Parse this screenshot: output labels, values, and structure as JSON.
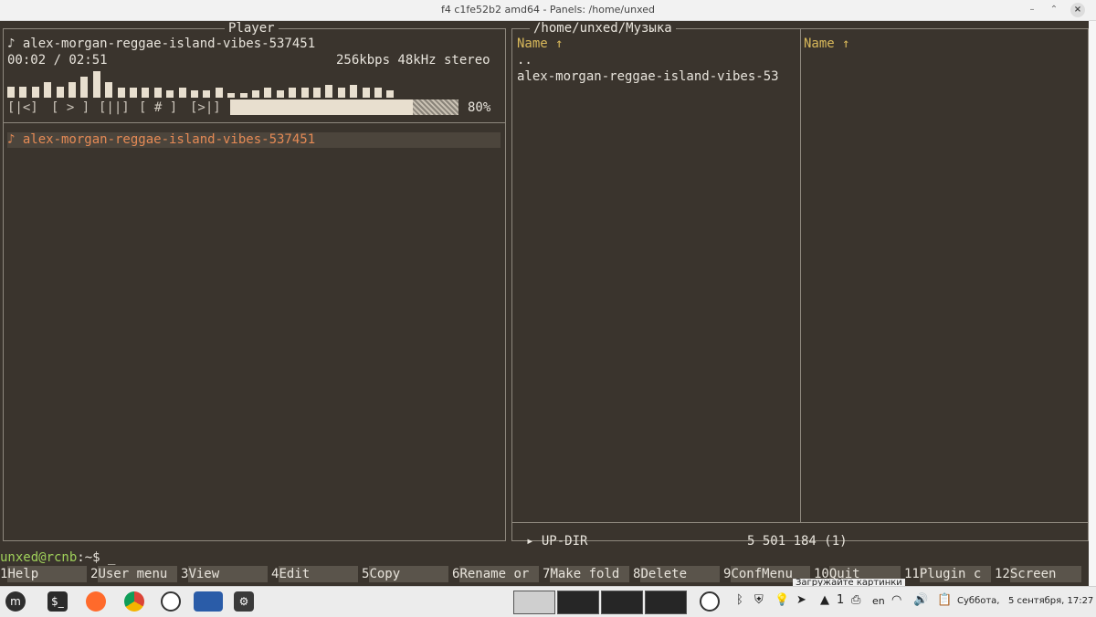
{
  "window": {
    "title": "f4 c1fe52b2 amd64 - Panels: /home/unxed",
    "minimize_glyph": "–",
    "maximize_glyph": "⌃",
    "close_glyph": "×"
  },
  "player": {
    "panel_title": "Player",
    "track_line": "♪ alex-morgan-reggae-island-vibes-537451",
    "time": "00:02 / 02:51",
    "format": "256kbps 48kHz stereo",
    "controls": {
      "prev": "[|<]",
      "play": "[ > ]",
      "pause": "[||]",
      "stop": "[ # ]",
      "next": "[>|]"
    },
    "progress_percent": 80,
    "progress_label": "80%",
    "elapsed_fraction": 0.012,
    "vu_levels": [
      0.4,
      0.4,
      0.4,
      0.55,
      0.4,
      0.55,
      0.75,
      0.95,
      0.55,
      0.35,
      0.35,
      0.35,
      0.35,
      0.25,
      0.35,
      0.25,
      0.25,
      0.35,
      0.15,
      0.15,
      0.25,
      0.35,
      0.25,
      0.35,
      0.35,
      0.35,
      0.45,
      0.35,
      0.45,
      0.35,
      0.35,
      0.25
    ],
    "playlist": [
      {
        "label": "♪ alex-morgan-reggae-island-vibes-537451",
        "selected": true
      }
    ]
  },
  "files": {
    "panel_title": "/home/unxed/Музыка",
    "col1_header": "Name ↑",
    "col2_header": "Name ↑",
    "items": [
      {
        "name": ".."
      },
      {
        "name": "alex-morgan-reggae-island-vibes-53"
      }
    ],
    "status_left": "▸ UP-DIR",
    "status_right": "5 501 184 (1)"
  },
  "prompt": {
    "user_host": "unxed@rcnb",
    "path_symbol": ":~$",
    "cursor": "_"
  },
  "fkeys": [
    {
      "num": "1",
      "label": "Help"
    },
    {
      "num": "2",
      "label": "User menu"
    },
    {
      "num": "3",
      "label": "View"
    },
    {
      "num": "4",
      "label": "Edit"
    },
    {
      "num": "5",
      "label": "Copy"
    },
    {
      "num": "6",
      "label": "Rename or"
    },
    {
      "num": "7",
      "label": "Make fold"
    },
    {
      "num": "8",
      "label": "Delete"
    },
    {
      "num": "9",
      "label": "ConfMenu"
    },
    {
      "num": "10",
      "label": "Quit"
    },
    {
      "num": "11",
      "label": "Plugin c"
    },
    {
      "num": "12",
      "label": "Screen"
    }
  ],
  "taskbar": {
    "tooltip": "Загружайте картинки",
    "apps": [
      {
        "icon": "mint-menu-icon"
      },
      {
        "icon": "terminal-icon",
        "glyph": "$_"
      },
      {
        "icon": "firefox-icon"
      },
      {
        "icon": "chrome-icon"
      },
      {
        "icon": "chatgpt-icon"
      },
      {
        "icon": "file-manager-icon"
      },
      {
        "icon": "settings-icon"
      }
    ],
    "tray_count": "1",
    "keyboard_layout": "en",
    "datetime": "Суббота,   5 сентября, 17:27",
    "colors": {
      "bg": "#ececec",
      "terminal_bg": "#3a342d",
      "accent_yellow": "#d8b85a",
      "accent_orange": "#e58a55"
    }
  }
}
